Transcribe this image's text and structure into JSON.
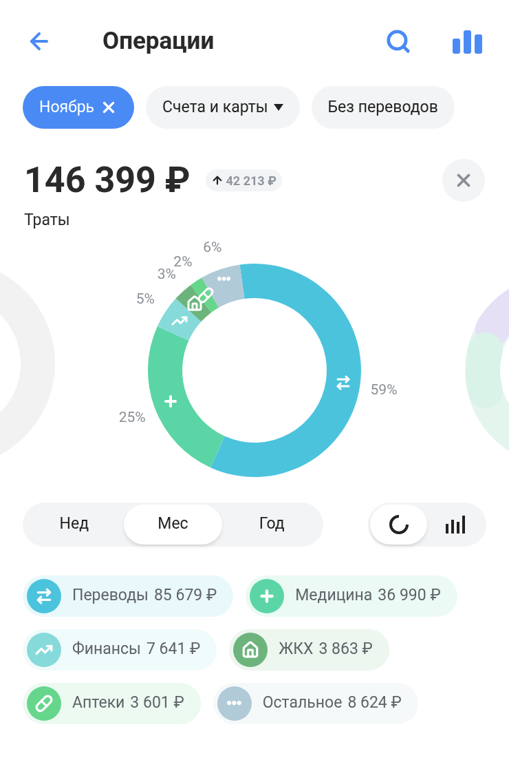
{
  "header": {
    "title": "Операции"
  },
  "filters": [
    {
      "label": "Ноябрь",
      "kind": "removable",
      "selected": true
    },
    {
      "label": "Счета и карты",
      "kind": "dropdown",
      "selected": false
    },
    {
      "label": "Без переводов",
      "kind": "plain",
      "selected": false
    }
  ],
  "summary": {
    "amount": "146 399 ₽",
    "change": "42 213 ₽",
    "caption": "Траты"
  },
  "chart": {
    "chart_data": {
      "type": "donut",
      "series": [
        {
          "values": [
            59,
            25,
            5,
            3,
            2,
            6
          ]
        }
      ],
      "value_labels": [
        "59%",
        "25%",
        "5%",
        "3%",
        "2%",
        "6%"
      ]
    }
  },
  "periods": [
    {
      "label": "Нед",
      "selected": false
    },
    {
      "label": "Мес",
      "selected": true
    },
    {
      "label": "Год",
      "selected": false
    }
  ],
  "views": [
    {
      "kind": "donut",
      "selected": true
    },
    {
      "kind": "bars",
      "selected": false
    }
  ],
  "legend": [
    {
      "kind": "transfer",
      "label": "Переводы",
      "amount": "85 679 ₽",
      "color": "#4cc3dd"
    },
    {
      "kind": "medicine",
      "label": "Медицина",
      "amount": "36 990 ₽",
      "color": "#5cd5a6"
    },
    {
      "kind": "finance",
      "label": "Финансы",
      "amount": "7 641 ₽",
      "color": "#86dada"
    },
    {
      "kind": "housing",
      "label": "ЖКХ",
      "amount": "3 863 ₽",
      "color": "#6cb47c"
    },
    {
      "kind": "pharmacy",
      "label": "Аптеки",
      "amount": "3 601 ₽",
      "color": "#66d68d"
    },
    {
      "kind": "other",
      "label": "Остальное",
      "amount": "8 624 ₽",
      "color": "#b1cad8"
    }
  ]
}
